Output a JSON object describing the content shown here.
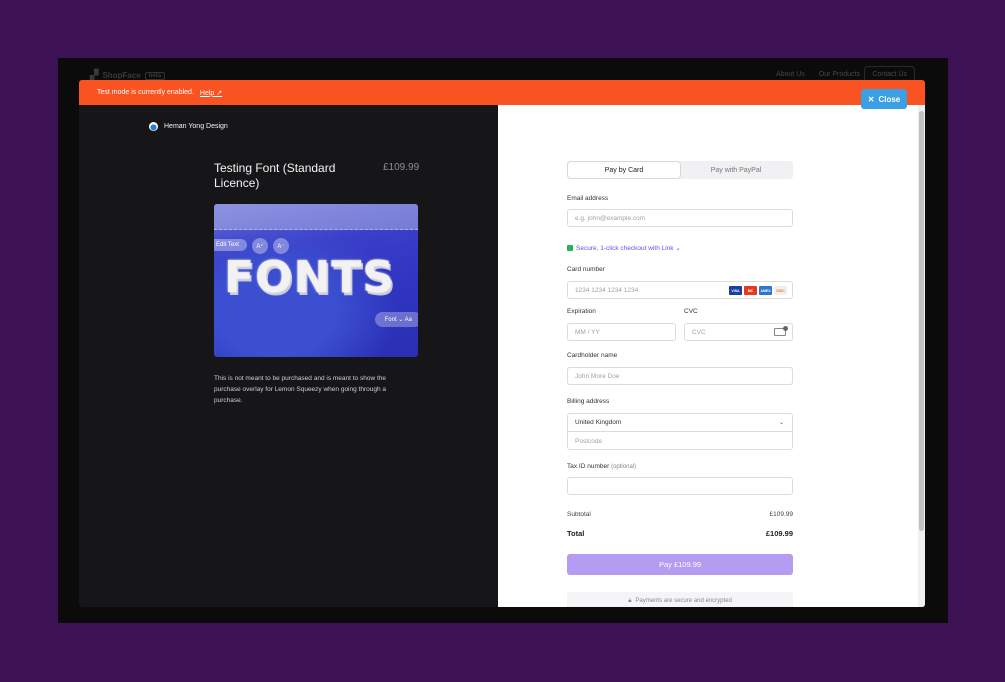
{
  "site": {
    "logo_text": "ShopFace",
    "logo_tag": "beta",
    "nav": [
      "About Us",
      "Our Products"
    ],
    "contact_label": "Contact Us"
  },
  "banner": {
    "text": "Test mode is currently enabled.",
    "help_label": "Help ↗"
  },
  "close_label": "Close",
  "store": {
    "name": "Heman Yong Design"
  },
  "product": {
    "title": "Testing Font (Standard Licence)",
    "price": "£109.99",
    "image": {
      "edit_text_label": "Edit Text",
      "size_up_label": "A⁺",
      "size_down_label": "A⁻",
      "word": "FONTS",
      "font_pill_label": "Font ⌄  Aa"
    },
    "description": "This is not meant to be purchased and is meant to show the purchase overlay for Lemon Squeezy when going through a purchase."
  },
  "checkout": {
    "tabs": [
      {
        "label": "Pay by Card",
        "active": true
      },
      {
        "label": "Pay with PayPal",
        "active": false
      }
    ],
    "email": {
      "label": "Email address",
      "placeholder": "e.g. john@example.com"
    },
    "secure_link": "Secure, 1-click checkout with Link ⌄",
    "card_number": {
      "label": "Card number",
      "placeholder": "1234 1234 1234 1234",
      "brands": [
        "VISA",
        "MC",
        "AMEX",
        "DISC"
      ]
    },
    "expiration": {
      "label": "Expiration",
      "placeholder": "MM / YY"
    },
    "cvc": {
      "label": "CVC",
      "placeholder": "CVC"
    },
    "cardholder": {
      "label": "Cardholder name",
      "placeholder": "John More Doe"
    },
    "billing": {
      "label": "Billing address",
      "country": "United Kingdom",
      "postcode_placeholder": "Postcode"
    },
    "tax": {
      "label": "Tax ID number",
      "optional": "(optional)"
    },
    "subtotal": {
      "label": "Subtotal",
      "value": "£109.99"
    },
    "total": {
      "label": "Total",
      "value": "£109.99"
    },
    "pay_button": "Pay £109.99",
    "footer": "Payments are secure and encrypted"
  },
  "colors": {
    "backdrop": "#3d1255",
    "banner": "#fa5322",
    "close_button": "#3b9fe6",
    "pay_button": "#b49cf3",
    "link": "#7348f0"
  }
}
